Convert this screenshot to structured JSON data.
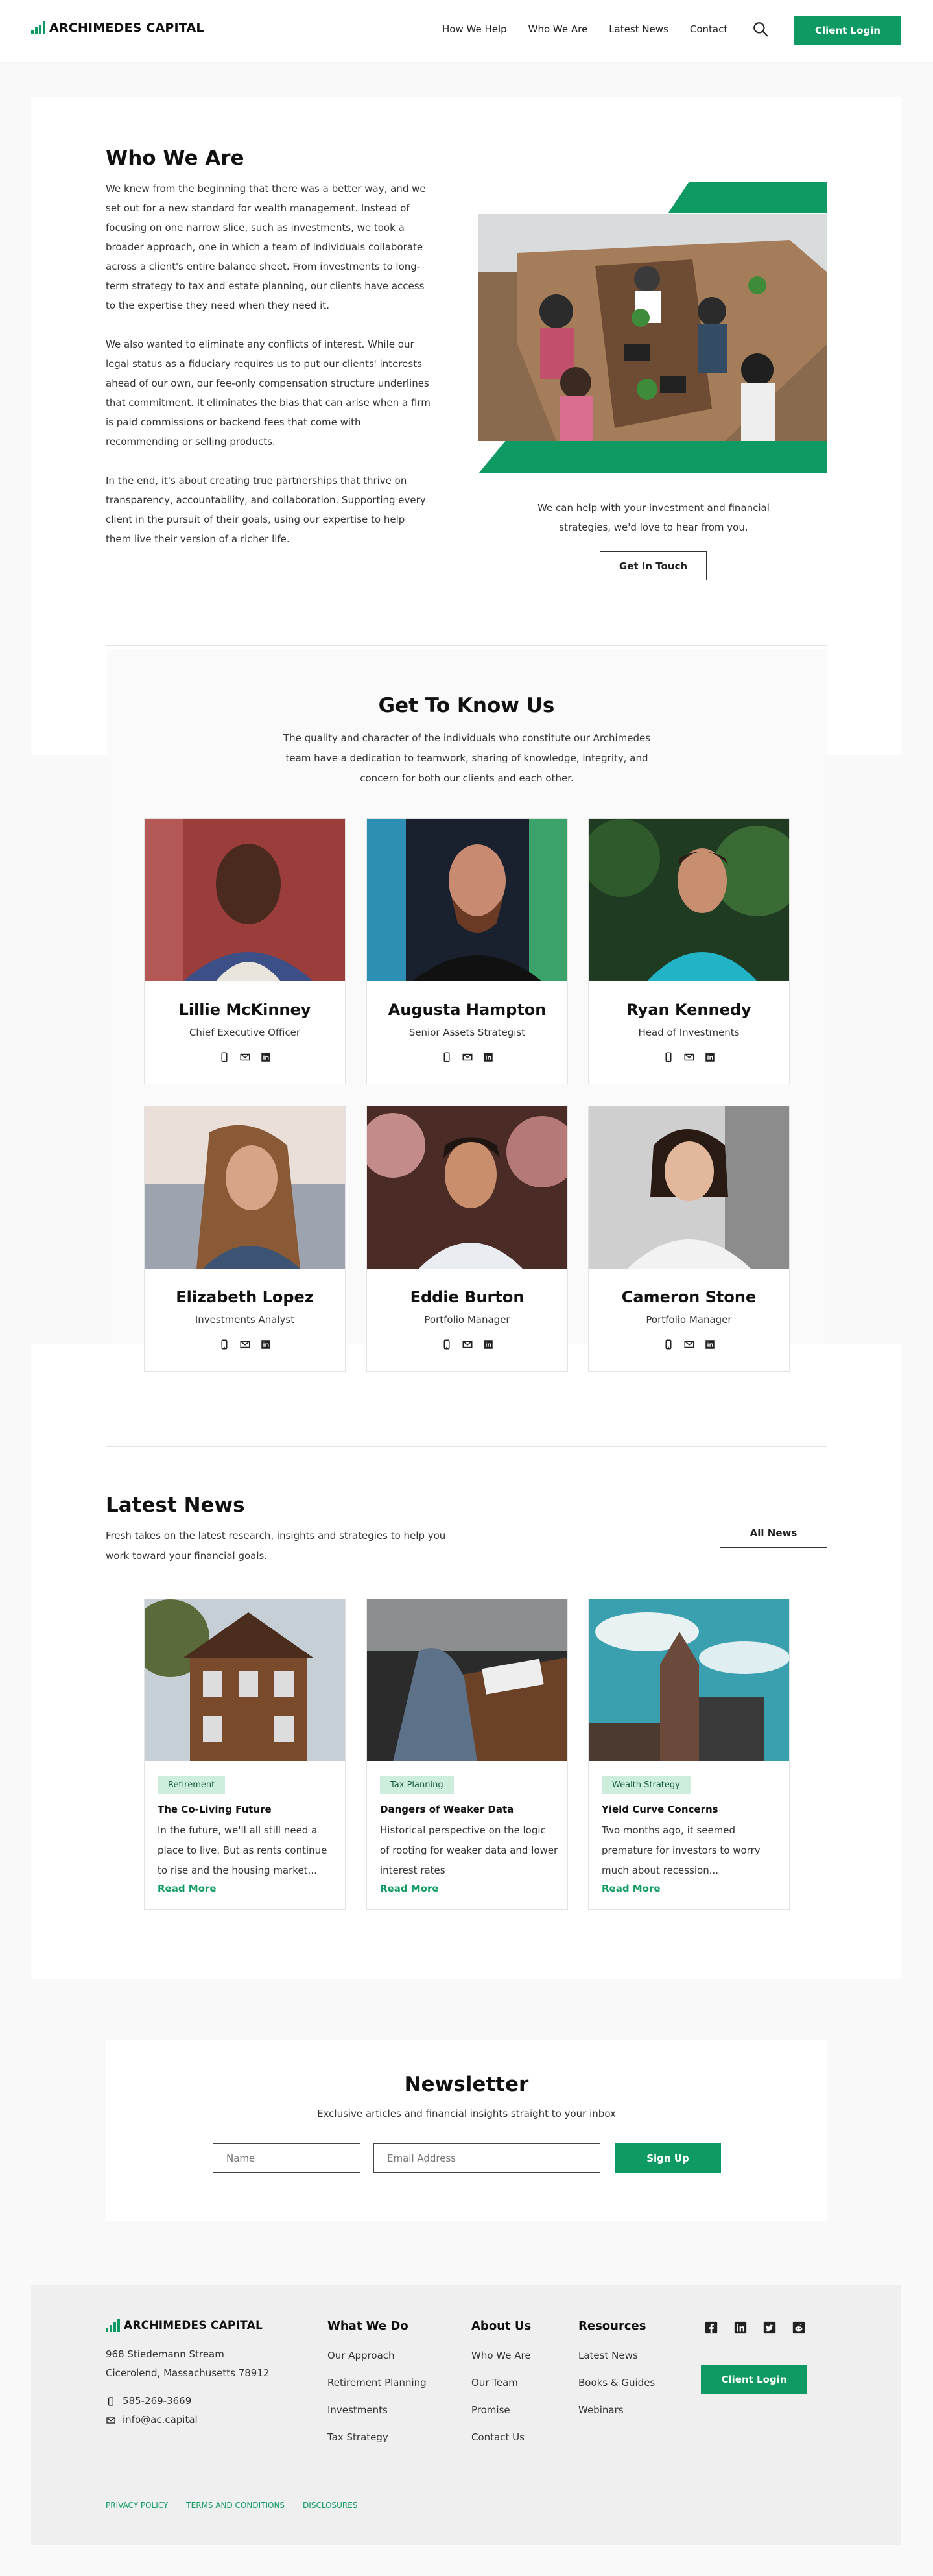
{
  "brand": {
    "name": "ARCHIMEDES CAPITAL",
    "accent": "#0e9a62"
  },
  "header": {
    "nav": [
      "How We Help",
      "Who We Are",
      "Latest News",
      "Contact"
    ],
    "login_label": "Client Login"
  },
  "who": {
    "title": "Who We Are",
    "paragraphs": [
      "We knew from the beginning that there was a better way, and we set out for a new standard for wealth management. Instead of focusing on one narrow slice, such as investments, we took a broader approach, one in which a team of individuals collaborate across a client's entire balance sheet. From investments to long-term strategy to tax and estate planning, our clients have access to the expertise they need when they need it.",
      "We also wanted to eliminate any conflicts of interest. While our legal status as a fiduciary requires us to put our clients' interests ahead of our own, our fee-only compensation structure underlines that commitment. It eliminates the bias that can arise when a firm is paid commissions or backend fees that come with recommending or selling products.",
      "In the end, it's about creating true partnerships that thrive on transparency, accountability, and collaboration. Supporting every client in the pursuit of their goals, using our expertise to help them live their version of a richer life."
    ],
    "cta_text": "We can help with your investment and financial strategies, we'd love to hear from you.",
    "cta_button": "Get In Touch"
  },
  "team": {
    "title": "Get To Know Us",
    "intro": "The quality and character of the individuals who constitute our Archimedes team have a dedication to teamwork, sharing of knowledge, integrity, and concern for both our clients and each other.",
    "members": [
      {
        "name": "Lillie McKinney",
        "role": "Chief Executive Officer"
      },
      {
        "name": "Augusta Hampton",
        "role": "Senior Assets Strategist"
      },
      {
        "name": "Ryan Kennedy",
        "role": "Head of Investments"
      },
      {
        "name": "Elizabeth Lopez",
        "role": "Investments Analyst"
      },
      {
        "name": "Eddie Burton",
        "role": "Portfolio Manager"
      },
      {
        "name": "Cameron Stone",
        "role": "Portfolio Manager"
      }
    ]
  },
  "news": {
    "title": "Latest News",
    "intro": "Fresh takes on the latest research, insights and strategies to help you work toward your financial goals.",
    "all_button": "All News",
    "read_more": "Read More",
    "articles": [
      {
        "tag": "Retirement",
        "title": "The Co-Living Future",
        "excerpt": "In the future, we'll all still need a place to live. But as rents continue to rise and the housing market..."
      },
      {
        "tag": "Tax Planning",
        "title": "Dangers of Weaker Data",
        "excerpt": "Historical perspective on the logic of rooting for weaker data and lower interest rates"
      },
      {
        "tag": "Wealth Strategy",
        "title": "Yield Curve Concerns",
        "excerpt": "Two months ago, it seemed premature for investors to worry much about recession..."
      }
    ]
  },
  "newsletter": {
    "title": "Newsletter",
    "subtitle": "Exclusive articles and financial insights straight to your inbox",
    "name_placeholder": "Name",
    "email_placeholder": "Email Address",
    "button": "Sign Up"
  },
  "footer": {
    "address_line1": "968 Stiedemann Stream",
    "address_line2": "Cicerolend, Massachusetts 78912",
    "phone": "585-269-3669",
    "email": "info@ac.capital",
    "col1": {
      "title": "What We Do",
      "links": [
        "Our Approach",
        "Retirement Planning",
        "Investments",
        "Tax Strategy"
      ]
    },
    "col2": {
      "title": "About Us",
      "links": [
        "Who We Are",
        "Our Team",
        "Promise",
        "Contact Us"
      ]
    },
    "col3": {
      "title": "Resources",
      "links": [
        "Latest News",
        "Books & Guides",
        "Webinars"
      ]
    },
    "login_label": "Client Login",
    "legal": [
      "PRIVACY POLICY",
      "TERMS AND CONDITIONS",
      "DISCLOSURES"
    ]
  }
}
